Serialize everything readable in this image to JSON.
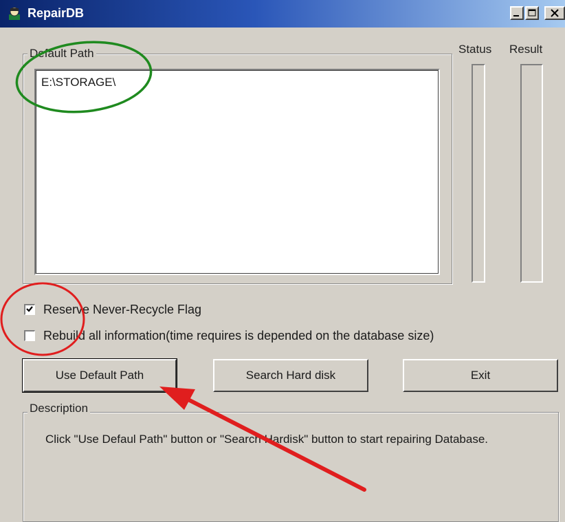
{
  "window": {
    "title": "RepairDB",
    "icon": "repairdb-app-icon",
    "controls": [
      "minimize-icon",
      "maximize-icon",
      "close-icon"
    ]
  },
  "path_group": {
    "label": "Default Path",
    "items": [
      "E:\\STORAGE\\"
    ]
  },
  "columns": {
    "status": "Status",
    "result": "Result"
  },
  "options": [
    {
      "label": "Reserve Never-Recycle Flag",
      "checked": true
    },
    {
      "label": "Rebuild all information(time requires is depended on the database size)",
      "checked": false
    }
  ],
  "buttons": {
    "use_default": "Use Default Path",
    "search": "Search Hard disk",
    "exit": "Exit"
  },
  "description": {
    "label": "Description",
    "text": "Click \"Use Defaul Path\" button or \"Search Hardisk\" button to start repairing Database."
  },
  "annotations": {
    "green_ellipse_color": "#1f8a1f",
    "red_circle_color": "#e01e1e",
    "arrow_color": "#e01e1e"
  }
}
